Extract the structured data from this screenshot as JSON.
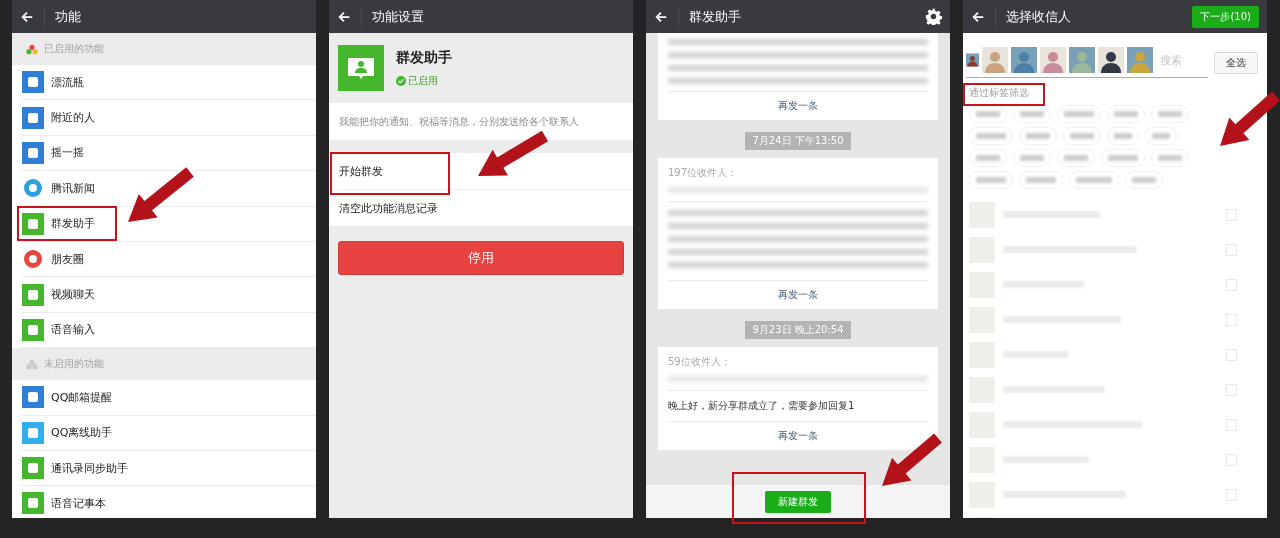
{
  "panels": [
    {
      "kind": "feature_list",
      "title": "功能",
      "sections": [
        {
          "label": "已启用的功能",
          "enabled": true,
          "items": [
            {
              "label": "漂流瓶",
              "kind": "tile",
              "color": "#2f7fd6"
            },
            {
              "label": "附近的人",
              "kind": "tile",
              "color": "#2f7fd6"
            },
            {
              "label": "摇一摇",
              "kind": "tile",
              "color": "#2f7fd6"
            },
            {
              "label": "腾讯新闻",
              "kind": "logo",
              "color": "#2f9fe0"
            },
            {
              "label": "群发助手",
              "kind": "tile",
              "color": "#44b72c"
            },
            {
              "label": "朋友圈",
              "kind": "logo",
              "color": "#e8453c"
            },
            {
              "label": "视频聊天",
              "kind": "tile",
              "color": "#44b72c"
            },
            {
              "label": "语音输入",
              "kind": "tile",
              "color": "#44b72c"
            }
          ]
        },
        {
          "label": "未启用的功能",
          "enabled": false,
          "items": [
            {
              "label": "QQ邮箱提醒",
              "kind": "tile",
              "color": "#2f7fd6"
            },
            {
              "label": "QQ离线助手",
              "kind": "tile",
              "color": "#30aef0"
            },
            {
              "label": "通讯录同步助手",
              "kind": "tile",
              "color": "#44b72c"
            },
            {
              "label": "语音记事本",
              "kind": "tile",
              "color": "#44b72c"
            }
          ]
        }
      ]
    },
    {
      "kind": "feature_settings",
      "title": "功能设置",
      "app_name": "群发助手",
      "status": "已启用",
      "enabled": true,
      "description": "我能把你的通知、祝福等消息，分别发送给各个联系人",
      "actions": [
        "开始群发",
        "清空此功能消息记录"
      ],
      "button": "停用"
    },
    {
      "kind": "broadcast_history",
      "title": "群发助手",
      "entries": [
        {
          "kind": "card",
          "action": "再发一条"
        },
        {
          "kind": "timestamp",
          "text": "7月24日 下午13:50"
        },
        {
          "kind": "card",
          "recipients": "197位收件人：",
          "action": "再发一条"
        },
        {
          "kind": "timestamp",
          "text": "9月23日 晚上20:54"
        },
        {
          "kind": "card",
          "recipients": "59位收件人：",
          "message": "晚上好，新分享群成立了，需要参加回复1",
          "action": "再发一条"
        }
      ],
      "new_button": "新建群发"
    },
    {
      "kind": "recipient_picker",
      "title": "选择收信人",
      "next_button": "下一步(10)",
      "search_placeholder": "搜索",
      "select_all": "全选",
      "filter_label": "通过标签筛选"
    }
  ]
}
